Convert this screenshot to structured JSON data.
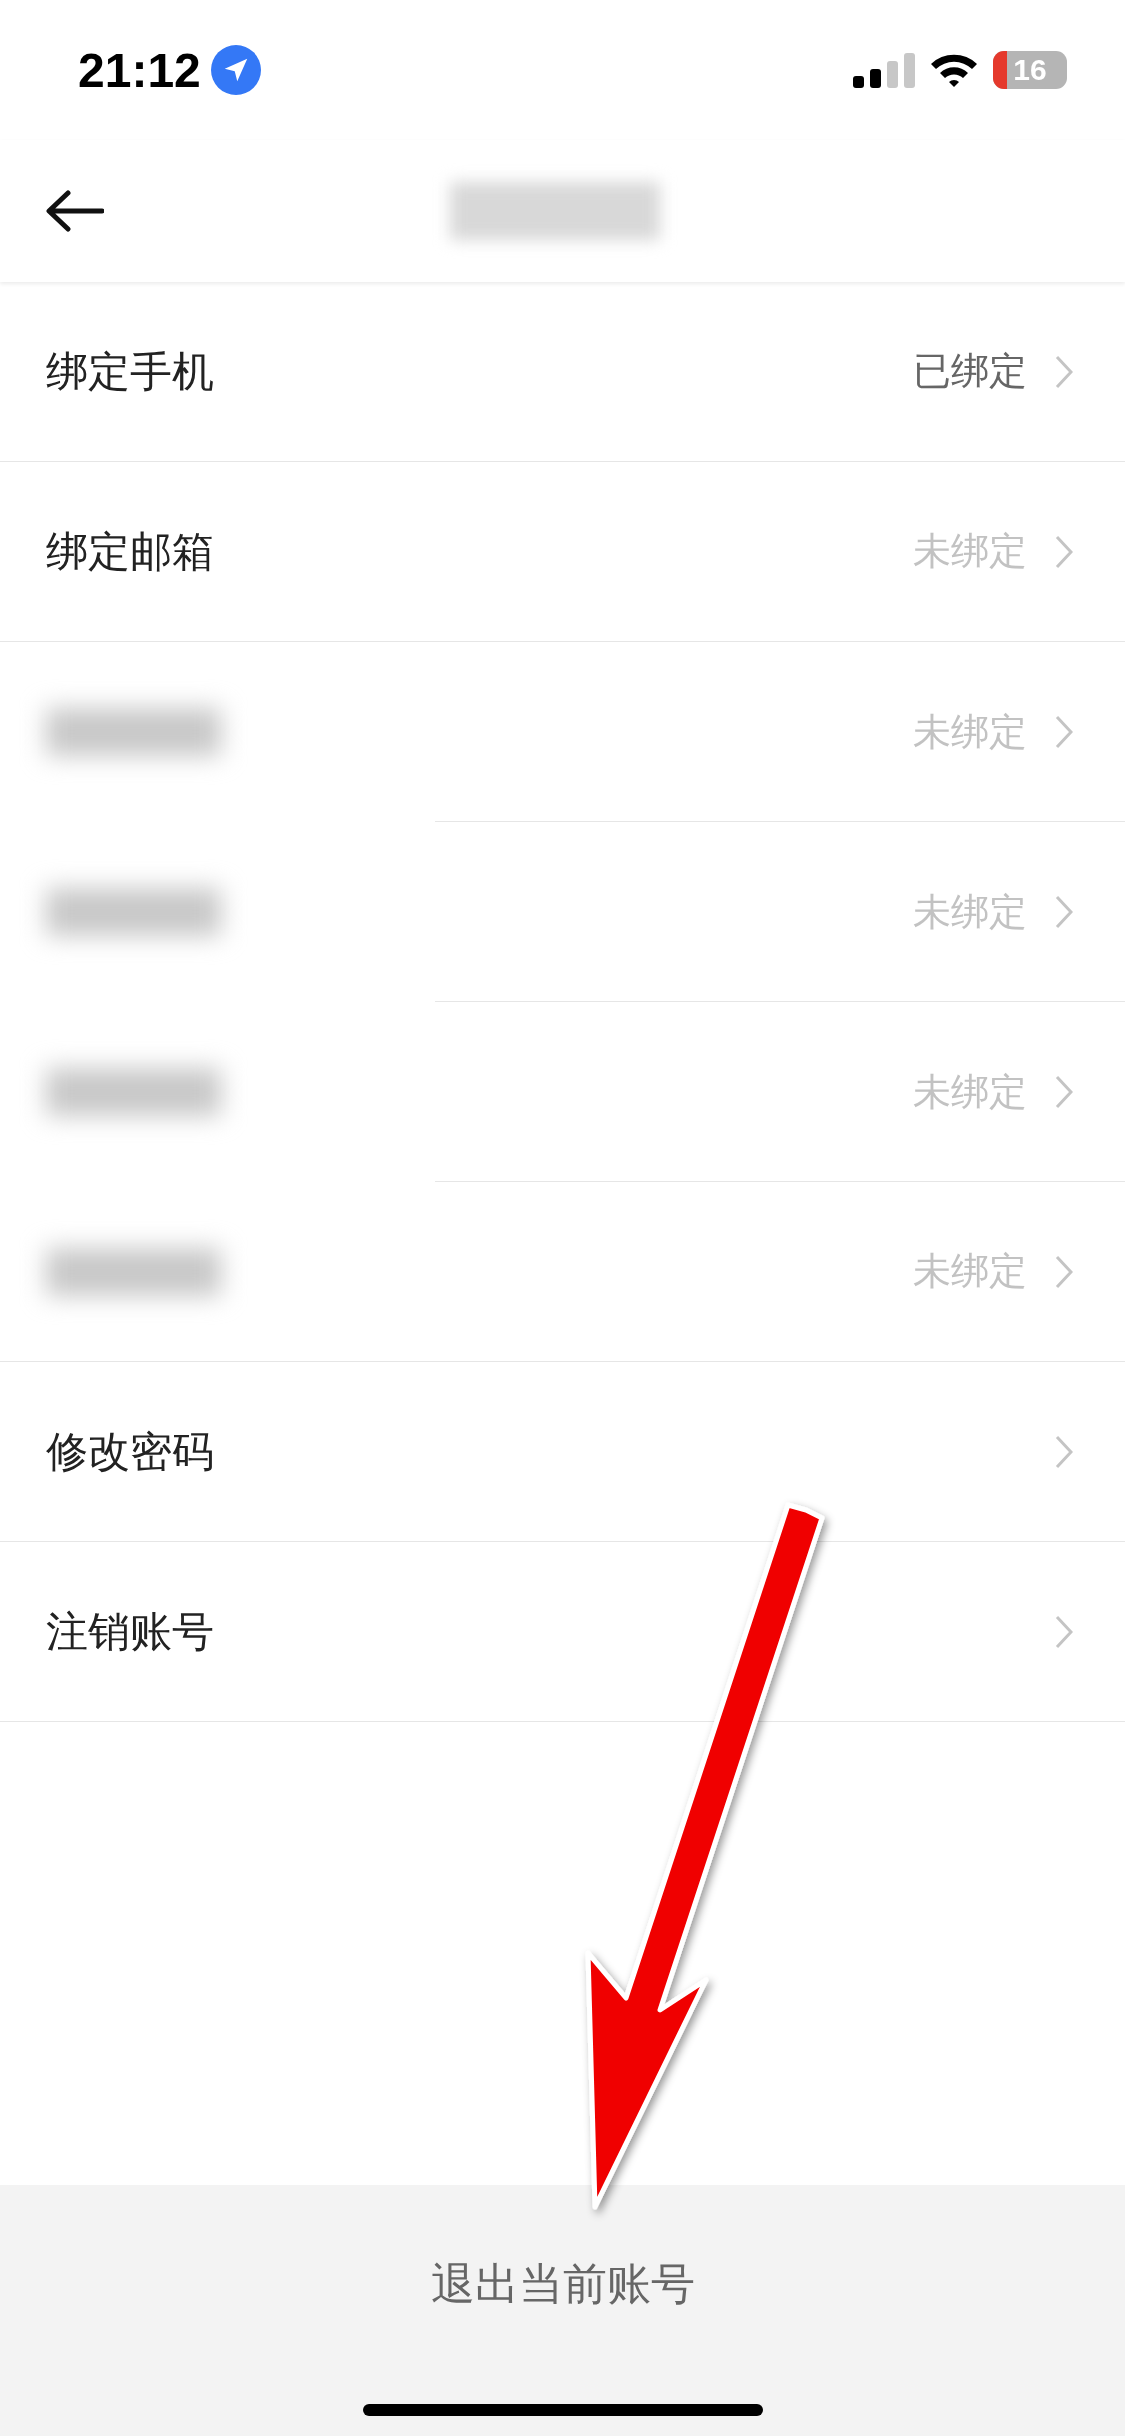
{
  "status_bar": {
    "time": "21:12",
    "battery_text": "16"
  },
  "nav_bar": {
    "title": {
      "kind": "blurred"
    }
  },
  "rows": [
    {
      "kind": "text",
      "label": "绑定手机",
      "value": "已绑定",
      "bound": true,
      "inset_divider": false
    },
    {
      "kind": "text",
      "label": "绑定邮箱",
      "value": "未绑定",
      "bound": false,
      "inset_divider": false
    },
    {
      "kind": "blurred",
      "value": "未绑定",
      "bound": false,
      "inset_divider": true
    },
    {
      "kind": "blurred",
      "value": "未绑定",
      "bound": false,
      "inset_divider": true
    },
    {
      "kind": "blurred",
      "value": "未绑定",
      "bound": false,
      "inset_divider": true
    },
    {
      "kind": "blurred",
      "value": "未绑定",
      "bound": false,
      "inset_divider": false
    },
    {
      "kind": "text",
      "label": "修改密码",
      "inset_divider": false
    },
    {
      "kind": "text",
      "label": "注销账号",
      "inset_divider": false
    }
  ],
  "annotation": {
    "kind": "arrow"
  },
  "footer": {
    "logout": "退出当前账号"
  }
}
